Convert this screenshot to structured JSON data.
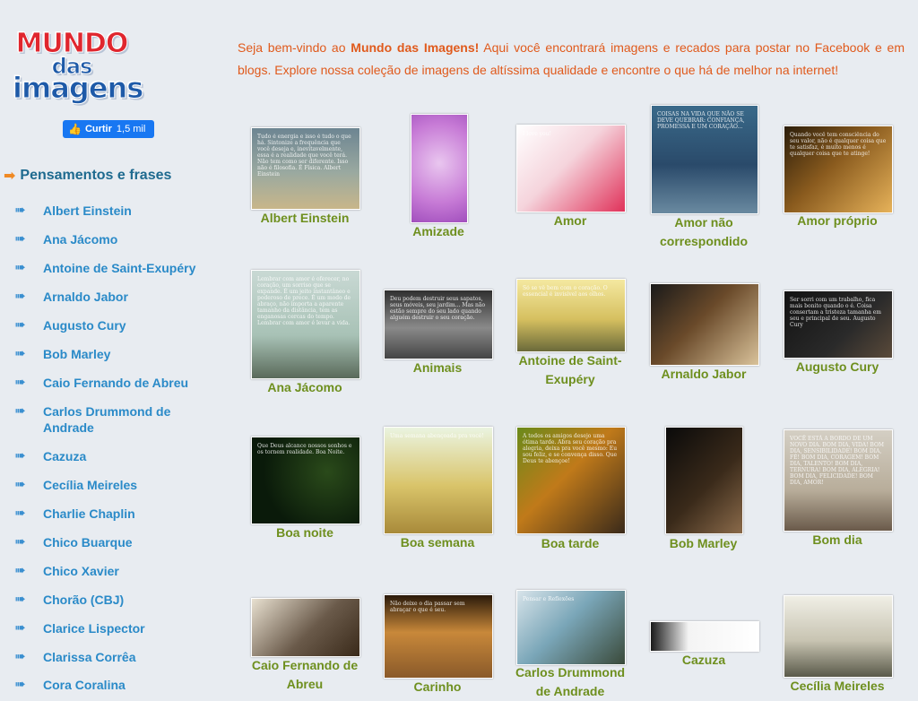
{
  "logo": {
    "line1": "MUNDO",
    "line2": "das",
    "line3": "imagens"
  },
  "like_button": {
    "label": "Curtir",
    "count": "1,5 mil"
  },
  "sidebar": {
    "section_title": "Pensamentos e frases",
    "items": [
      "Albert Einstein",
      "Ana Jácomo",
      "Antoine de Saint-Exupéry",
      "Arnaldo Jabor",
      "Augusto Cury",
      "Bob Marley",
      "Caio Fernando de Abreu",
      "Carlos Drummond de Andrade",
      "Cazuza",
      "Cecília Meireles",
      "Charlie Chaplin",
      "Chico Buarque",
      "Chico Xavier",
      "Chorão (CBJ)",
      "Clarice Lispector",
      "Clarissa Corrêa",
      "Cora Coralina"
    ]
  },
  "intro": {
    "before": "Seja bem-vindo ao ",
    "site_name": "Mundo das Imagens!",
    "after": " Aqui você encontrará imagens e recados para postar no Facebook e em blogs. Explore nossa coleção de imagens de altíssima qualidade e encontre o que há de melhor na internet!"
  },
  "gallery": [
    {
      "caption": "Albert Einstein",
      "thumb_text": "Tudo é energia e isso é tudo o que há. Sintonize a frequência que você deseja e, inevitavelmente, essa é a realidade que você terá. Não tem como ser diferente. Isso não é filosofia. É Física. Albert Einstein"
    },
    {
      "caption": "Amizade",
      "thumb_text": ""
    },
    {
      "caption": "Amor",
      "thumb_text": "I love you!"
    },
    {
      "caption": "Amor não correspondido",
      "thumb_text": "COISAS NA VIDA QUE NÃO SE DEVE QUEBRAR: CONFIANÇA, PROMESSA E UM CORAÇÃO..."
    },
    {
      "caption": "Amor próprio",
      "thumb_text": "Quando você tem consciência do seu valor, não é qualquer coisa que te satisfaz, é muito menos é qualquer coisa que te atinge!"
    },
    {
      "caption": "Ana Jácomo",
      "thumb_text": "Lembrar com amor é oferecer, no coração, um sorriso que se expande. É um jeito instantâneo e poderoso de prece. É um modo de abraço, não importa a aparente tamanho da distância, tem as enganosas cercas do tempo. Lembrar com amor é levar a vida."
    },
    {
      "caption": "Animais",
      "thumb_text": "Deu podem destruir seus sapatos, seus móveis, seu jardim... Mas não estão sempre do seu lado quando alguém destruir o seu coração."
    },
    {
      "caption": "Antoine de Saint-Exupéry",
      "thumb_text": "Só se vê bem com o coração. O essencial é invisível aos olhos."
    },
    {
      "caption": "Arnaldo Jabor",
      "thumb_text": ""
    },
    {
      "caption": "Augusto Cury",
      "thumb_text": "Ser sorri com um trabalho, fica mais bonito quando o é. Coisa consertam a tristeza tamanha em seu e principal de seu. Augusto Cury"
    },
    {
      "caption": "Boa noite",
      "thumb_text": "Que Deus alcance nossos sonhos e os tornem realidade. Boa Noite."
    },
    {
      "caption": "Boa semana",
      "thumb_text": "Uma semana abençoada pra você!"
    },
    {
      "caption": "Boa tarde",
      "thumb_text": "A todos os amigos desejo uma ótima tarde. Abra seu coração pra alegria, deixa pra você mesmo: Eu sou feliz, e se convença disso. Que Deus te abençoe!"
    },
    {
      "caption": "Bob Marley",
      "thumb_text": ""
    },
    {
      "caption": "Bom dia",
      "thumb_text": "VOCÊ ESTÁ A BORDO DE UM NOVO DIA. BOM DIA, VIDA! BOM DIA, SENSIBILIDADE! BOM DIA, FÉ! BOM DIA, CORAGEM! BOM DIA, TALENTO! BOM DIA, TERNURA! BOM DIA, ALEGRIA! BOM DIA, FELICIDADE! BOM DIA, AMOR!"
    },
    {
      "caption": "Caio Fernando de Abreu",
      "thumb_text": ""
    },
    {
      "caption": "Carinho",
      "thumb_text": "Não deixe o dia passar sem abraçar o que é seu."
    },
    {
      "caption": "Carlos Drummond de Andrade",
      "thumb_text": "Pensar e Reflexões"
    },
    {
      "caption": "Cazuza",
      "thumb_text": ""
    },
    {
      "caption": "Cecília Meireles",
      "thumb_text": ""
    }
  ],
  "colors": {
    "background": "#e8ecf1",
    "intro_text": "#e05a1c",
    "caption": "#6e8f1e",
    "sidebar_link": "#2a8ac8",
    "section_title": "#1e6a8f",
    "logo_red": "#e0262e",
    "logo_blue": "#1e5aa8",
    "facebook": "#1877f2"
  }
}
